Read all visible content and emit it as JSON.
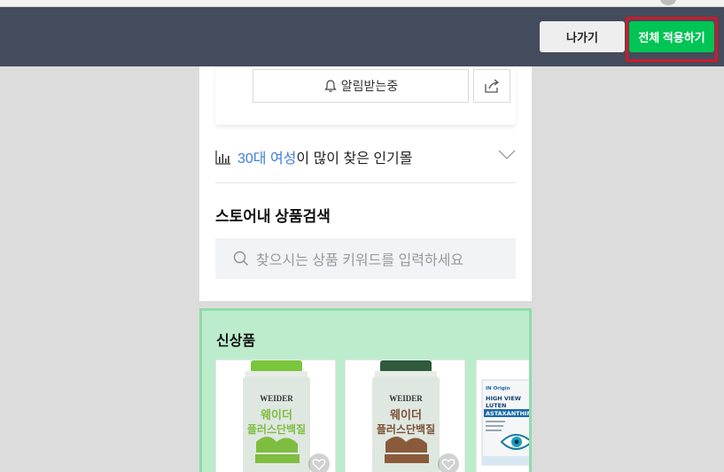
{
  "editor_bar": {
    "exit_label": "나가기",
    "apply_label": "전체 적용하기",
    "colors": {
      "bar": "#434c5c",
      "apply": "#00c454",
      "highlight_outline": "#d0192a"
    }
  },
  "store": {
    "notify_label": "알림받는중",
    "popular": {
      "age_gender": "30대 여성",
      "suffix": "이 많이 찾은 인기몰"
    },
    "search": {
      "title": "스토어내 상품검색",
      "placeholder": "찾으시는 상품 키워드를 입력하세요"
    }
  },
  "new_products": {
    "title": "신상품",
    "items": [
      {
        "brand": "WEIDER",
        "name_line1": "웨이더",
        "name_line2": "플러스단백질",
        "lid_color": "#79c63a",
        "body_color": "#7fbd3f",
        "icon": "heart-icon"
      },
      {
        "brand": "WEIDER",
        "name_line1": "웨이더",
        "name_line2": "플러스단백질",
        "lid_color": "#2f5a3c",
        "body_color": "#8a5b3a",
        "icon": "heart-icon"
      },
      {
        "brand": "IN Origin",
        "name_line1": "HIGH VIEW",
        "name_line2": "LUTEN",
        "name_line3": "ASTAXANTHIN",
        "icon": "eye-icon"
      }
    ]
  }
}
